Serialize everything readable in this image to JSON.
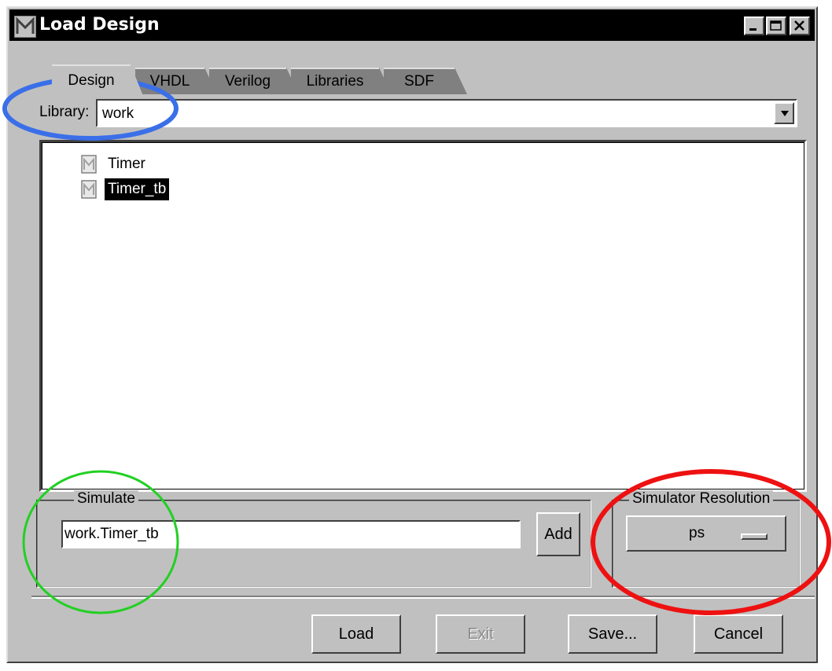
{
  "window": {
    "title": "Load Design"
  },
  "tabs": [
    {
      "label": "Design",
      "active": true
    },
    {
      "label": "VHDL",
      "active": false
    },
    {
      "label": "Verilog",
      "active": false
    },
    {
      "label": "Libraries",
      "active": false
    },
    {
      "label": "SDF",
      "active": false
    }
  ],
  "library": {
    "label": "Library:",
    "value": "work"
  },
  "design_list": {
    "items": [
      {
        "label": "Timer",
        "icon": "module-icon",
        "selected": false
      },
      {
        "label": "Timer_tb",
        "icon": "module-icon",
        "selected": true
      }
    ]
  },
  "simulate": {
    "group_title": "Simulate",
    "value": "work.Timer_tb",
    "add_label": "Add"
  },
  "resolution": {
    "group_title": "Simulator Resolution",
    "selected": "ps"
  },
  "buttons": {
    "load": "Load",
    "exit": "Exit",
    "save": "Save...",
    "cancel": "Cancel"
  },
  "annotations": {
    "colors": {
      "library_highlight": "#3a6fe8",
      "simulate_highlight": "#22d022",
      "resolution_highlight": "#ee1111"
    }
  }
}
